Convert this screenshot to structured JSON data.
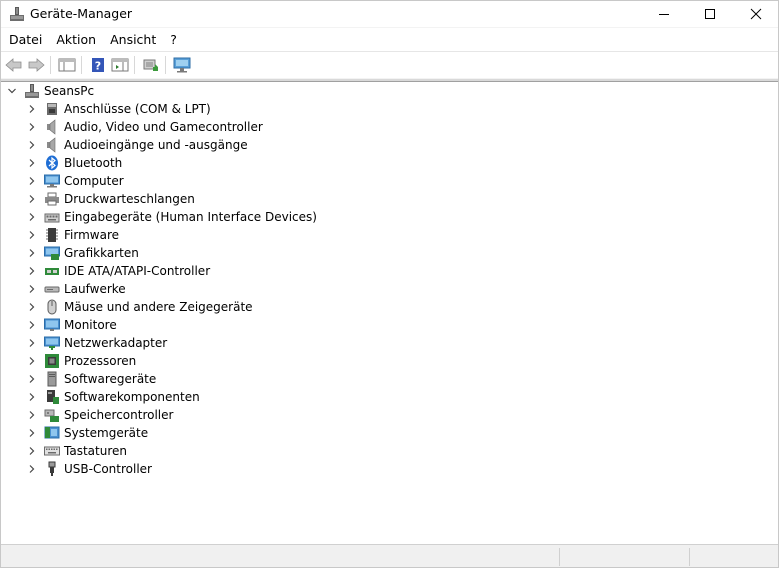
{
  "window": {
    "title": "Geräte-Manager"
  },
  "menu": {
    "items": [
      "Datei",
      "Aktion",
      "Ansicht",
      "?"
    ]
  },
  "tree": {
    "root_label": "SeansPc",
    "items": [
      {
        "label": "Anschlüsse (COM & LPT)",
        "icon": "port-icon"
      },
      {
        "label": "Audio, Video und Gamecontroller",
        "icon": "speaker-icon"
      },
      {
        "label": "Audioeingänge und -ausgänge",
        "icon": "speaker-icon"
      },
      {
        "label": "Bluetooth",
        "icon": "bluetooth-icon"
      },
      {
        "label": "Computer",
        "icon": "computer-icon"
      },
      {
        "label": "Druckwarteschlangen",
        "icon": "printer-icon"
      },
      {
        "label": "Eingabegeräte (Human Interface Devices)",
        "icon": "keyboard-hid-icon"
      },
      {
        "label": "Firmware",
        "icon": "chip-icon"
      },
      {
        "label": "Grafikkarten",
        "icon": "display-adapter-icon"
      },
      {
        "label": "IDE ATA/ATAPI-Controller",
        "icon": "ide-controller-icon"
      },
      {
        "label": "Laufwerke",
        "icon": "disk-drive-icon"
      },
      {
        "label": "Mäuse und andere Zeigegeräte",
        "icon": "mouse-icon"
      },
      {
        "label": "Monitore",
        "icon": "monitor-icon"
      },
      {
        "label": "Netzwerkadapter",
        "icon": "network-adapter-icon"
      },
      {
        "label": "Prozessoren",
        "icon": "processor-icon"
      },
      {
        "label": "Softwaregeräte",
        "icon": "software-device-icon"
      },
      {
        "label": "Softwarekomponenten",
        "icon": "software-component-icon"
      },
      {
        "label": "Speichercontroller",
        "icon": "storage-controller-icon"
      },
      {
        "label": "Systemgeräte",
        "icon": "system-device-icon"
      },
      {
        "label": "Tastaturen",
        "icon": "keyboard-icon"
      },
      {
        "label": "USB-Controller",
        "icon": "usb-icon"
      }
    ]
  }
}
